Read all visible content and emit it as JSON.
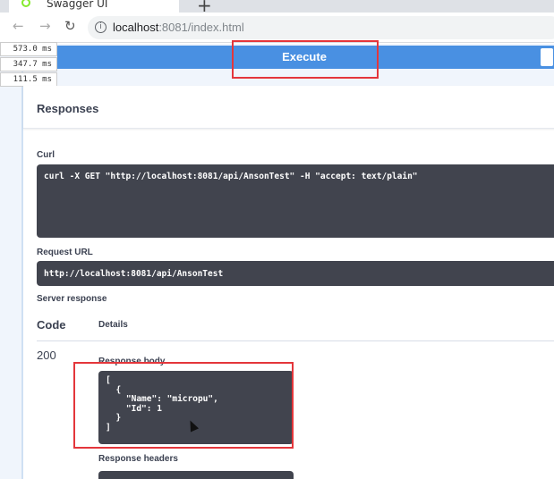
{
  "browser": {
    "tab_title": "Swagger UI",
    "new_tab": "+",
    "url_host": "localhost",
    "url_rest": ":8081/index.html",
    "icons": [
      "back-icon",
      "forward-icon",
      "reload-icon",
      "info-icon",
      "swagger-favicon"
    ]
  },
  "timings": [
    "573.0 ms",
    "347.7 ms",
    "111.5 ms"
  ],
  "execute": {
    "label": "Execute",
    "color": "#4990e2"
  },
  "responses": {
    "title": "Responses",
    "curl_label": "Curl",
    "curl_command": "curl -X GET \"http://localhost:8081/api/AnsonTest\" -H \"accept: text/plain\"",
    "request_url_label": "Request URL",
    "request_url": "http://localhost:8081/api/AnsonTest",
    "server_response_label": "Server response",
    "code_header": "Code",
    "details_header": "Details",
    "status_code": "200",
    "response_body_label": "Response body",
    "response_body": "[\n  {\n    \"Name\": \"micropu\",\n    \"Id\": 1\n  }\n]",
    "response_headers_label": "Response headers"
  },
  "highlight_color": "#e4363b"
}
